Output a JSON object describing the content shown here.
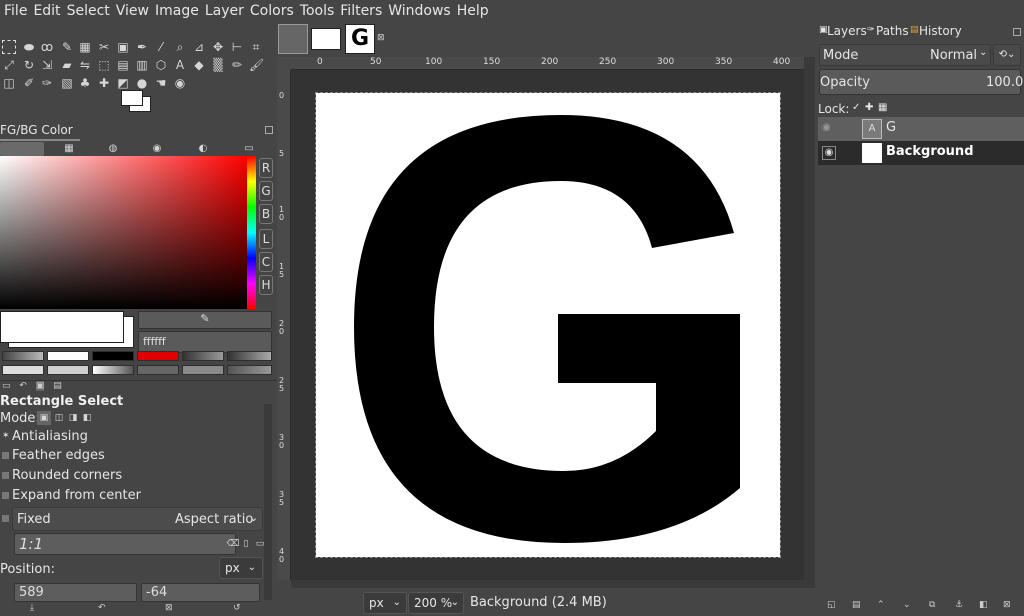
{
  "menu": [
    "File",
    "Edit",
    "Select",
    "View",
    "Image",
    "Layer",
    "Colors",
    "Tools",
    "Filters",
    "Windows",
    "Help"
  ],
  "fgbg": {
    "tab_label": "FG/BG Color",
    "hex": "ffffff",
    "channels": [
      "R",
      "G",
      "B",
      "L",
      "C",
      "H"
    ]
  },
  "palette_colors": [
    "#a9a9a9",
    "#ffffff",
    "#000000",
    "#e00000",
    "#777777",
    "#888888",
    "#dddddd",
    "#cfcfcf",
    "#aaaaaa",
    "#666666",
    "#8a8a8a",
    "#999999"
  ],
  "tool_options": {
    "title": "Rectangle Select",
    "mode_label": "Mode:",
    "antialiasing": "Antialiasing",
    "feather": "Feather edges",
    "rounded": "Rounded corners",
    "expand": "Expand from center",
    "fixed": "Fixed",
    "aspect": "Aspect ratio",
    "ratio_value": "1:1",
    "position_label": "Position:",
    "unit": "px",
    "pos_x": "589",
    "pos_y": "-64"
  },
  "canvas": {
    "letter": "G",
    "ruler_h": [
      "0",
      "50",
      "100",
      "150",
      "200",
      "250",
      "300",
      "350",
      "400"
    ],
    "ruler_v": [
      "0",
      "5",
      "1\n0",
      "1\n5",
      "2\n0",
      "2\n5",
      "3\n0",
      "3\n5",
      "4\n0",
      "4\n5"
    ]
  },
  "status": {
    "unit": "px",
    "zoom": "200 %",
    "info": "Background (2.4 MB)"
  },
  "layers_panel": {
    "tabs": [
      "Layers",
      "Paths",
      "History"
    ],
    "mode_label": "Mode",
    "mode_value": "Normal",
    "opacity_label": "Opacity",
    "opacity_value": "100.0",
    "lock_label": "Lock:",
    "layers": [
      {
        "name": "G"
      },
      {
        "name": "Background"
      }
    ]
  }
}
